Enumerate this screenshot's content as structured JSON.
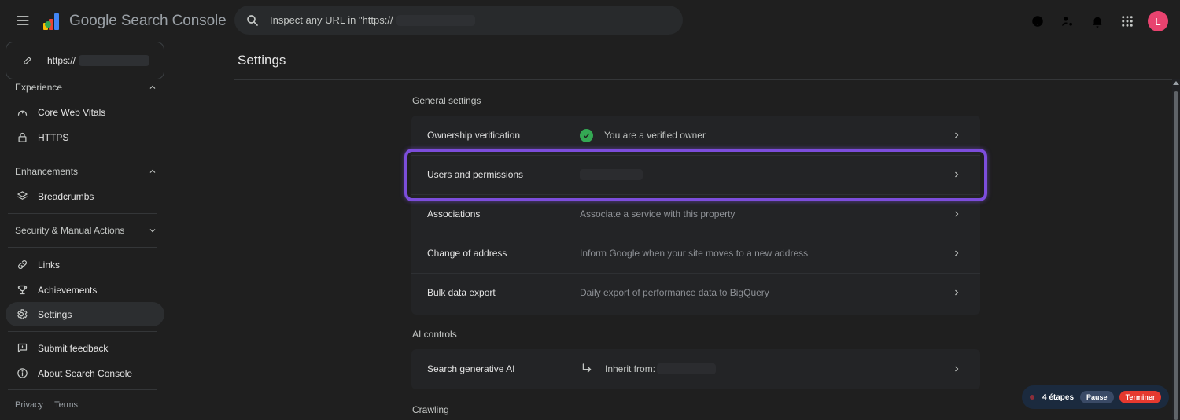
{
  "header": {
    "brand": "Google Search Console",
    "search_prefix": "Inspect any URL in \"https://",
    "avatar_letter": "L"
  },
  "sidebar": {
    "property_url": "https://",
    "sections": {
      "experience": "Experience",
      "enhancements": "Enhancements",
      "security": "Security & Manual Actions"
    },
    "items": {
      "core_web_vitals": "Core Web Vitals",
      "https": "HTTPS",
      "breadcrumbs": "Breadcrumbs",
      "links": "Links",
      "achievements": "Achievements",
      "settings": "Settings",
      "submit_feedback": "Submit feedback",
      "about": "About Search Console"
    },
    "footer": {
      "privacy": "Privacy",
      "terms": "Terms"
    }
  },
  "main": {
    "title": "Settings",
    "general_label": "General settings",
    "general_rows": [
      {
        "name": "Ownership verification",
        "desc": "You are a verified owner"
      },
      {
        "name": "Users and permissions",
        "desc": ""
      },
      {
        "name": "Associations",
        "desc": "Associate a service with this property"
      },
      {
        "name": "Change of address",
        "desc": "Inform Google when your site moves to a new address"
      },
      {
        "name": "Bulk data export",
        "desc": "Daily export of performance data to BigQuery"
      }
    ],
    "ai_label": "AI controls",
    "ai_rows": [
      {
        "name": "Search generative AI",
        "desc": "Inherit from:"
      }
    ],
    "crawling_label": "Crawling"
  },
  "recorder": {
    "steps": "4 étapes",
    "pause": "Pause",
    "stop": "Terminer"
  },
  "colors": {
    "background": "#1f1f1f",
    "card": "#232426",
    "highlight": "#7c4ddb",
    "verified": "#34a853",
    "avatar": "#e8436f",
    "stop": "#e5392f"
  }
}
